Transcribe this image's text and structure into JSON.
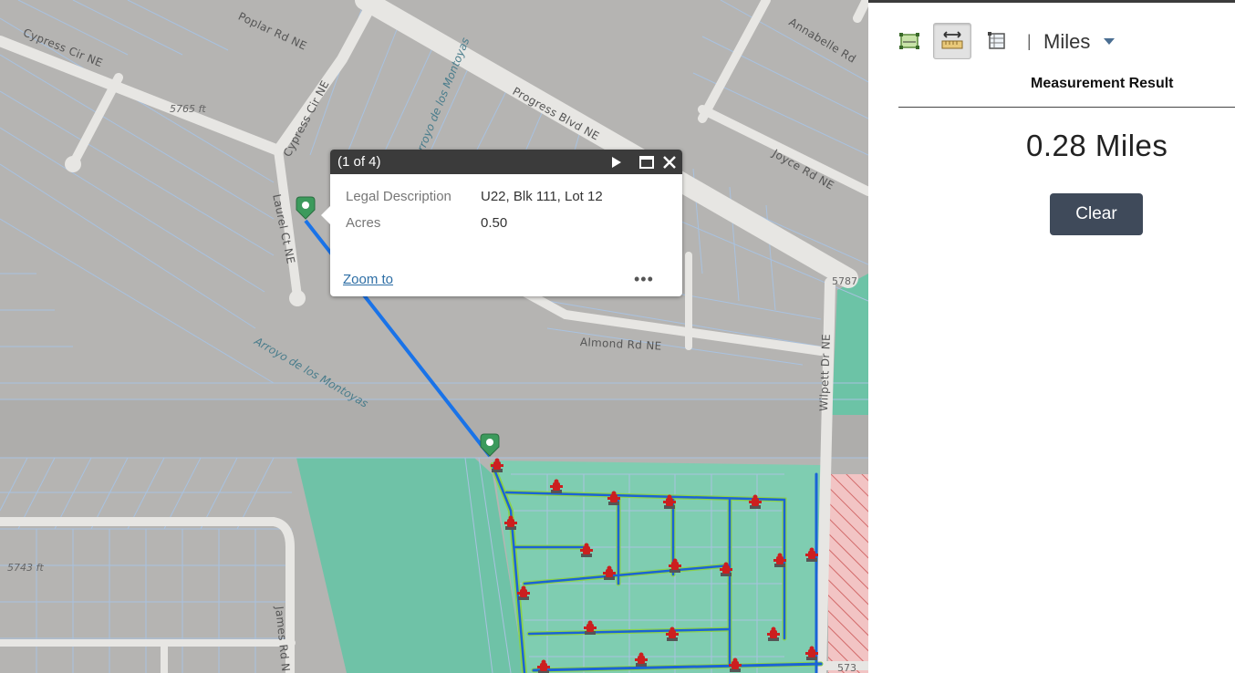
{
  "map": {
    "road_labels": [
      {
        "text": "Poplar Rd NE"
      },
      {
        "text": "Cypress Cir NE"
      },
      {
        "text": "Cypress Cir NE"
      },
      {
        "text": "Progress Blvd NE"
      },
      {
        "text": "Annabelle Rd"
      },
      {
        "text": "Joyce Rd NE"
      },
      {
        "text": "Laurel Ct NE"
      },
      {
        "text": "Almond Rd NE"
      },
      {
        "text": "Wilpett Dr NE"
      },
      {
        "text": "James Rd N"
      }
    ],
    "arroyo_labels": [
      {
        "text": "Arroyo de los Montoyas"
      },
      {
        "text": "Arroyo de los Montoyas"
      }
    ],
    "elevation_labels": [
      {
        "text": "5765 ft"
      },
      {
        "text": "5743 ft"
      },
      {
        "text": "5787"
      },
      {
        "text": "573"
      }
    ],
    "colors": {
      "base": "#b5b4b2",
      "parcel_line": "#a9c2e0",
      "park": "#6cc3a6",
      "measure_line": "#1a73e8",
      "hydrant": "#cc1f1f",
      "marker": "#3c9a5c",
      "hatch": "#e68a8a"
    }
  },
  "popup": {
    "title": "(1 of 4)",
    "fields": [
      {
        "label": "Legal Description",
        "value": "U22, Blk 111, Lot 12"
      },
      {
        "label": "Acres",
        "value": "0.50"
      }
    ],
    "zoom_label": "Zoom to",
    "more_label": "•••",
    "icons": [
      "play-icon",
      "maximize-icon",
      "close-icon"
    ]
  },
  "panel": {
    "tools": [
      "area-tool-icon",
      "distance-tool-icon",
      "location-tool-icon"
    ],
    "separator": "|",
    "unit": "Miles",
    "result_heading": "Measurement Result",
    "result_value": "0.28 Miles",
    "clear_label": "Clear",
    "colors": {
      "clear_bg": "#3f4a5a",
      "caret": "#4a6e92"
    }
  }
}
